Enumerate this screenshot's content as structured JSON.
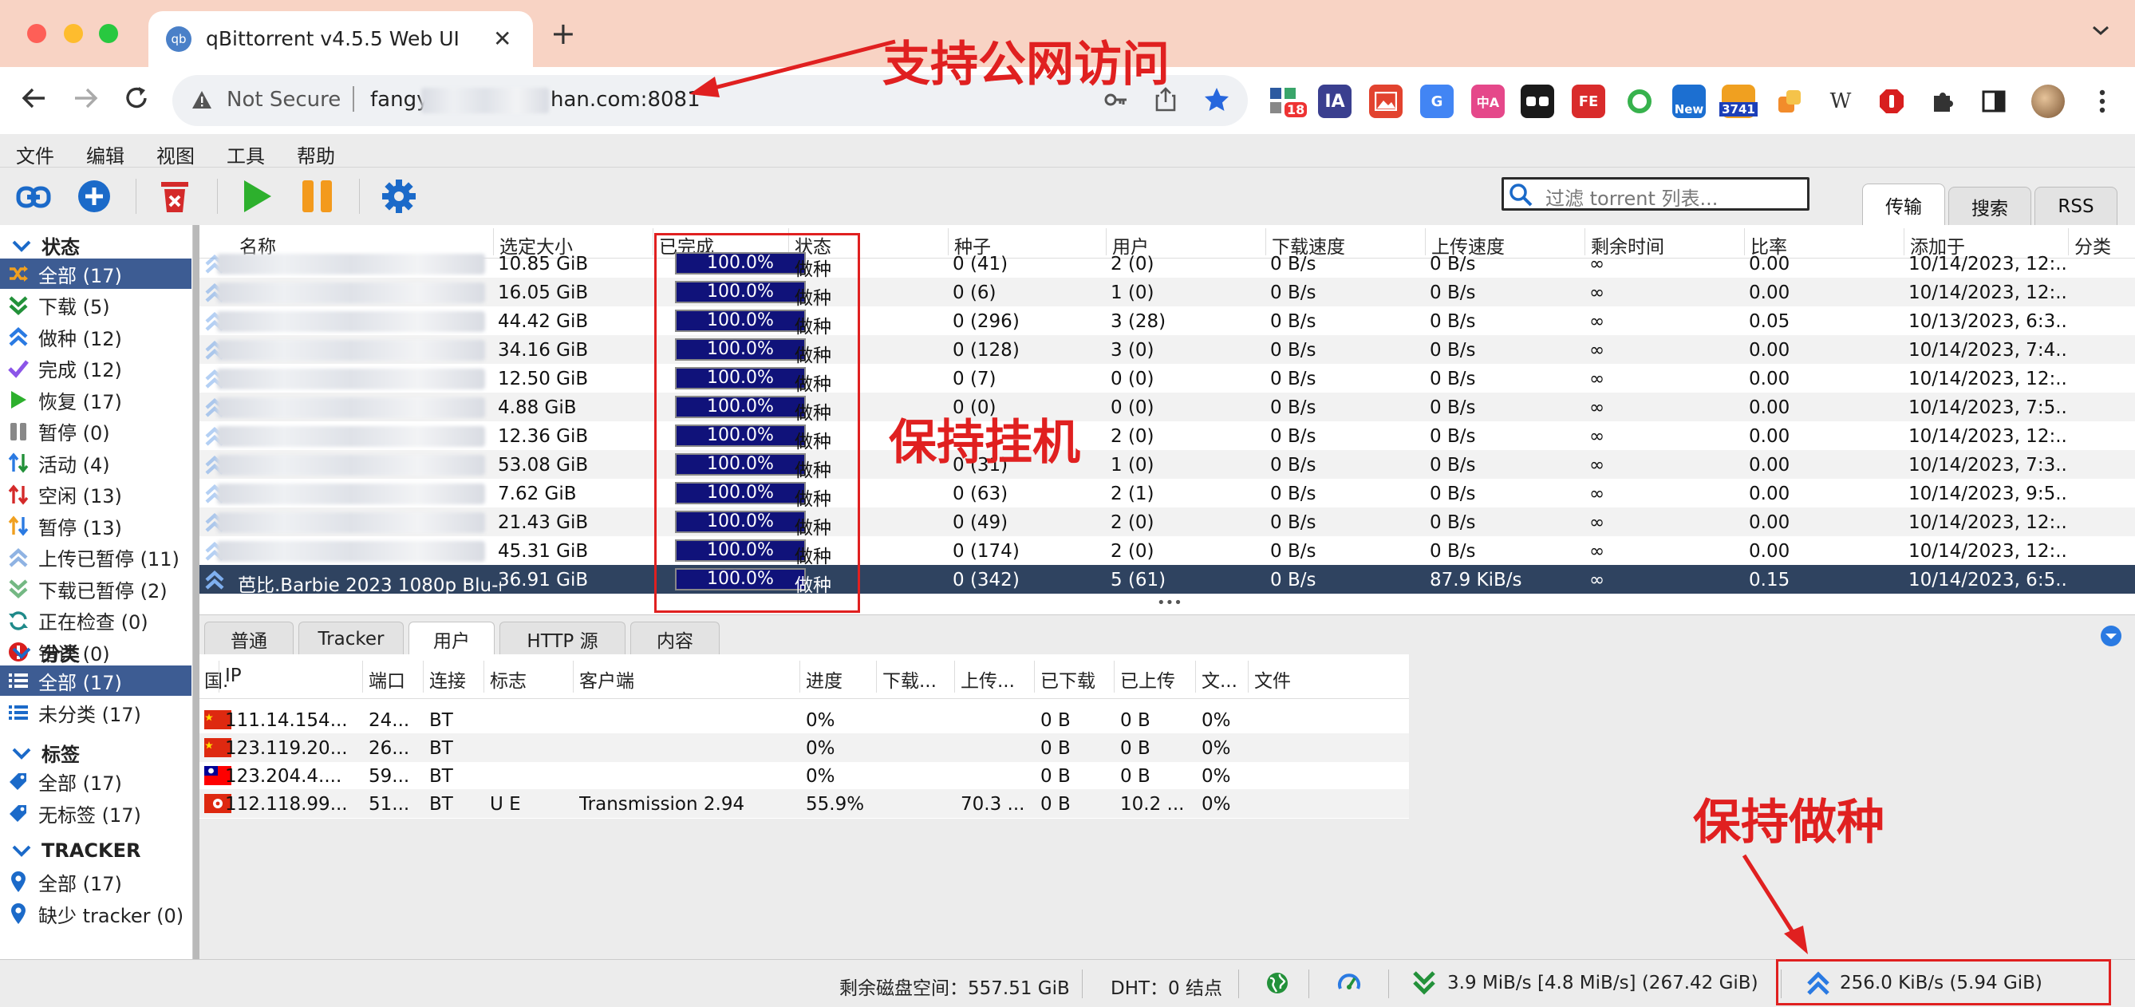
{
  "browser": {
    "tab_title": "qBittorrent v4.5.5 Web UI",
    "tab_favicon_text": "qb",
    "not_secure": "Not Secure",
    "url_prefix": "fangy",
    "url_suffix": "han.com:8081",
    "ext_badges": {
      "mail": "18",
      "new": "New",
      "count": "3741",
      "ia": "IA",
      "w": "W"
    }
  },
  "menu": [
    "文件",
    "编辑",
    "视图",
    "工具",
    "帮助"
  ],
  "filter_placeholder": "过滤 torrent 列表...",
  "right_tabs": [
    "传输",
    "搜索",
    "RSS"
  ],
  "sidebar": {
    "status_head": "状态",
    "status": [
      {
        "label": "全部 (17)",
        "icon": "shuffle-icon",
        "selected": true
      },
      {
        "label": "下载 (5)",
        "icon": "download-icon"
      },
      {
        "label": "做种 (12)",
        "icon": "upload-icon"
      },
      {
        "label": "完成 (12)",
        "icon": "check-icon"
      },
      {
        "label": "恢复 (17)",
        "icon": "play-icon"
      },
      {
        "label": "暂停 (0)",
        "icon": "pause-icon"
      },
      {
        "label": "活动 (4)",
        "icon": "updown-icon"
      },
      {
        "label": "空闲 (13)",
        "icon": "idle-icon"
      },
      {
        "label": "暂停 (13)",
        "icon": "stalled-icon"
      },
      {
        "label": "上传已暂停 (11)",
        "icon": "upload-paused-icon"
      },
      {
        "label": "下载已暂停 (2)",
        "icon": "download-paused-icon"
      },
      {
        "label": "正在检查 (0)",
        "icon": "checking-icon"
      },
      {
        "label": "错误 (0)",
        "icon": "error-icon"
      }
    ],
    "cat_head": "分类",
    "categories": [
      {
        "label": "全部 (17)",
        "selected": true
      },
      {
        "label": "未分类 (17)"
      }
    ],
    "tag_head": "标签",
    "tags": [
      {
        "label": "全部 (17)"
      },
      {
        "label": "无标签 (17)"
      }
    ],
    "tracker_head": "TRACKER",
    "trackers": [
      {
        "label": "全部 (17)"
      },
      {
        "label": "缺少 tracker (0)"
      }
    ]
  },
  "torrent_columns": [
    "名称",
    "选定大小",
    "已完成",
    "状态",
    "种子",
    "用户",
    "下载速度",
    "上传速度",
    "剩余时间",
    "比率",
    "添加于",
    "分类"
  ],
  "torrents": [
    {
      "name": "",
      "size": "10.85 GiB",
      "progress": "100.0%",
      "status": "做种",
      "seeds": "0 (41)",
      "peers": "2 (0)",
      "dl": "0 B/s",
      "ul": "0 B/s",
      "eta": "∞",
      "ratio": "0.00",
      "added": "10/14/2023, 12:..."
    },
    {
      "name": "",
      "size": "16.05 GiB",
      "progress": "100.0%",
      "status": "做种",
      "seeds": "0 (6)",
      "peers": "1 (0)",
      "dl": "0 B/s",
      "ul": "0 B/s",
      "eta": "∞",
      "ratio": "0.00",
      "added": "10/14/2023, 12:..."
    },
    {
      "name": "",
      "size": "44.42 GiB",
      "progress": "100.0%",
      "status": "做种",
      "seeds": "0 (296)",
      "peers": "3 (28)",
      "dl": "0 B/s",
      "ul": "0 B/s",
      "eta": "∞",
      "ratio": "0.05",
      "added": "10/13/2023, 6:3..."
    },
    {
      "name": "",
      "size": "34.16 GiB",
      "progress": "100.0%",
      "status": "做种",
      "seeds": "0 (128)",
      "peers": "3 (0)",
      "dl": "0 B/s",
      "ul": "0 B/s",
      "eta": "∞",
      "ratio": "0.00",
      "added": "10/14/2023, 7:4..."
    },
    {
      "name": "",
      "size": "12.50 GiB",
      "progress": "100.0%",
      "status": "做种",
      "seeds": "0 (7)",
      "peers": "0 (0)",
      "dl": "0 B/s",
      "ul": "0 B/s",
      "eta": "∞",
      "ratio": "0.00",
      "added": "10/14/2023, 12:..."
    },
    {
      "name": "",
      "size": "4.88 GiB",
      "progress": "100.0%",
      "status": "做种",
      "seeds": "0 (0)",
      "peers": "0 (0)",
      "dl": "0 B/s",
      "ul": "0 B/s",
      "eta": "∞",
      "ratio": "0.00",
      "added": "10/14/2023, 7:5..."
    },
    {
      "name": "",
      "size": "12.36 GiB",
      "progress": "100.0%",
      "status": "做种",
      "seeds": "",
      "peers": "2 (0)",
      "dl": "0 B/s",
      "ul": "0 B/s",
      "eta": "∞",
      "ratio": "0.00",
      "added": "10/14/2023, 12:..."
    },
    {
      "name": "",
      "size": "53.08 GiB",
      "progress": "100.0%",
      "status": "做种",
      "seeds": "0 (31)",
      "peers": "1 (0)",
      "dl": "0 B/s",
      "ul": "0 B/s",
      "eta": "∞",
      "ratio": "0.00",
      "added": "10/14/2023, 7:3..."
    },
    {
      "name": "",
      "size": "7.62 GiB",
      "progress": "100.0%",
      "status": "做种",
      "seeds": "0 (63)",
      "peers": "2 (1)",
      "dl": "0 B/s",
      "ul": "0 B/s",
      "eta": "∞",
      "ratio": "0.00",
      "added": "10/14/2023, 9:5..."
    },
    {
      "name": "",
      "size": "21.43 GiB",
      "progress": "100.0%",
      "status": "做种",
      "seeds": "0 (49)",
      "peers": "2 (0)",
      "dl": "0 B/s",
      "ul": "0 B/s",
      "eta": "∞",
      "ratio": "0.00",
      "added": "10/14/2023, 12:..."
    },
    {
      "name": "",
      "size": "45.31 GiB",
      "progress": "100.0%",
      "status": "做种",
      "seeds": "0 (174)",
      "peers": "2 (0)",
      "dl": "0 B/s",
      "ul": "0 B/s",
      "eta": "∞",
      "ratio": "0.00",
      "added": "10/14/2023, 12:..."
    },
    {
      "name": "芭比.Barbie 2023 1080p Blu-r...",
      "size": "36.91 GiB",
      "progress": "100.0%",
      "status": "做种",
      "seeds": "0 (342)",
      "peers": "5 (61)",
      "dl": "0 B/s",
      "ul": "87.9 KiB/s",
      "eta": "∞",
      "ratio": "0.15",
      "added": "10/14/2023, 6:5...",
      "selected": true
    }
  ],
  "detail_tabs": [
    "普通",
    "Tracker",
    "用户",
    "HTTP 源",
    "内容"
  ],
  "peer_columns": [
    "国.",
    "IP",
    "端口",
    "连接",
    "标志",
    "客户端",
    "进度",
    "下载...",
    "上传...",
    "已下载",
    "已上传",
    "文...",
    "文件"
  ],
  "peers": [
    {
      "flag": "cn",
      "ip": "111.14.154...",
      "port": "24...",
      "conn": "BT",
      "flags": "",
      "client": "",
      "progress": "0%",
      "dl": "",
      "ul": "",
      "downloaded": "0 B",
      "uploaded": "0 B",
      "rel": "0%"
    },
    {
      "flag": "cn",
      "ip": "123.119.20...",
      "port": "26...",
      "conn": "BT",
      "flags": "",
      "client": "",
      "progress": "0%",
      "dl": "",
      "ul": "",
      "downloaded": "0 B",
      "uploaded": "0 B",
      "rel": "0%"
    },
    {
      "flag": "tw",
      "ip": "123.204.4....",
      "port": "59...",
      "conn": "BT",
      "flags": "",
      "client": "",
      "progress": "0%",
      "dl": "",
      "ul": "",
      "downloaded": "0 B",
      "uploaded": "0 B",
      "rel": "0%"
    },
    {
      "flag": "hk",
      "ip": "112.118.99...",
      "port": "51...",
      "conn": "BT",
      "flags": "U E",
      "client": "Transmission 2.94",
      "progress": "55.9%",
      "dl": "",
      "ul": "70.3 ...",
      "downloaded": "0 B",
      "uploaded": "10.2 ...",
      "rel": "0%"
    }
  ],
  "status": {
    "disk": "剩余磁盘空间：557.51 GiB",
    "dht": "DHT：0 结点",
    "dl": "3.9 MiB/s [4.8 MiB/s] (267.42 GiB)",
    "ul": "256.0 KiB/s (5.94 GiB)"
  },
  "annotations": {
    "public": "支持公网访问",
    "keep": "保持挂机",
    "seeding": "保持做种"
  },
  "colors": {
    "accent": "#3d5c93",
    "annotation": "#e02020",
    "progress": "#10127a"
  }
}
